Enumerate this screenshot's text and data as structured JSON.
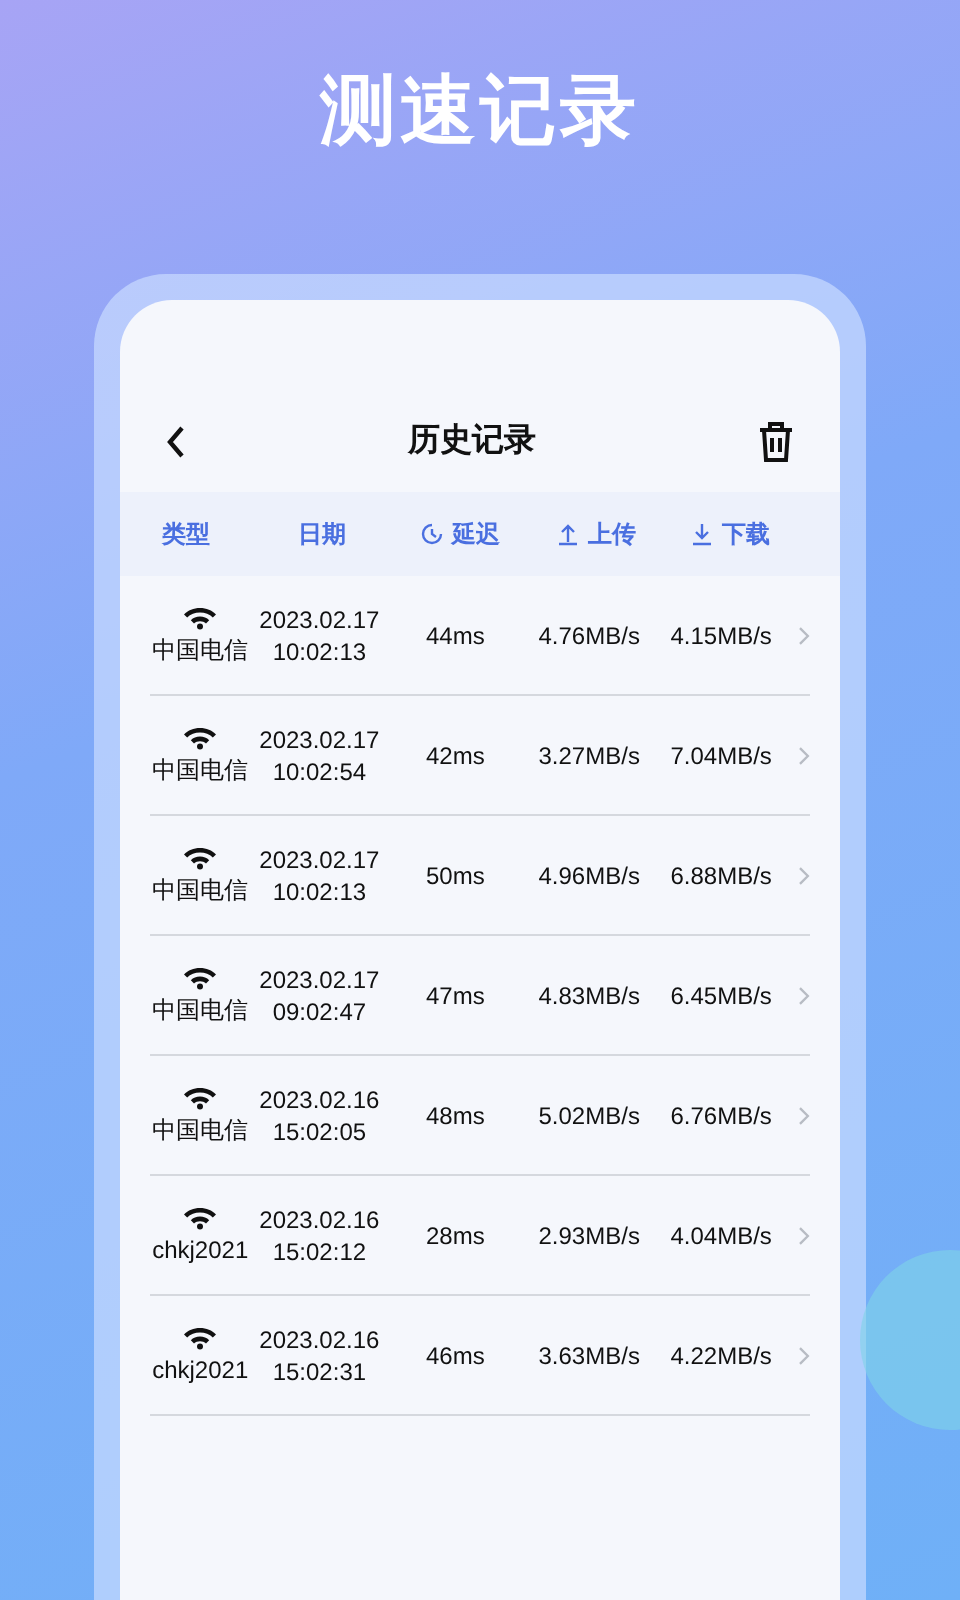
{
  "banner_title": "测速记录",
  "screen": {
    "title": "历史记录",
    "columns": [
      {
        "label": "类型",
        "kind": "plain"
      },
      {
        "label": "日期",
        "kind": "plain"
      },
      {
        "label": "延迟",
        "kind": "latency"
      },
      {
        "label": "上传",
        "kind": "upload"
      },
      {
        "label": "下载",
        "kind": "download"
      }
    ],
    "rows": [
      {
        "network": "中国电信",
        "date": "2023.02.17",
        "time": "10:02:13",
        "latency": "44ms",
        "upload": "4.76MB/s",
        "download": "4.15MB/s"
      },
      {
        "network": "中国电信",
        "date": "2023.02.17",
        "time": "10:02:54",
        "latency": "42ms",
        "upload": "3.27MB/s",
        "download": "7.04MB/s"
      },
      {
        "network": "中国电信",
        "date": "2023.02.17",
        "time": "10:02:13",
        "latency": "50ms",
        "upload": "4.96MB/s",
        "download": "6.88MB/s"
      },
      {
        "network": "中国电信",
        "date": "2023.02.17",
        "time": "09:02:47",
        "latency": "47ms",
        "upload": "4.83MB/s",
        "download": "6.45MB/s"
      },
      {
        "network": "中国电信",
        "date": "2023.02.16",
        "time": "15:02:05",
        "latency": "48ms",
        "upload": "5.02MB/s",
        "download": "6.76MB/s"
      },
      {
        "network": "chkj2021",
        "date": "2023.02.16",
        "time": "15:02:12",
        "latency": "28ms",
        "upload": "2.93MB/s",
        "download": "4.04MB/s"
      },
      {
        "network": "chkj2021",
        "date": "2023.02.16",
        "time": "15:02:31",
        "latency": "46ms",
        "upload": "3.63MB/s",
        "download": "4.22MB/s"
      }
    ]
  }
}
